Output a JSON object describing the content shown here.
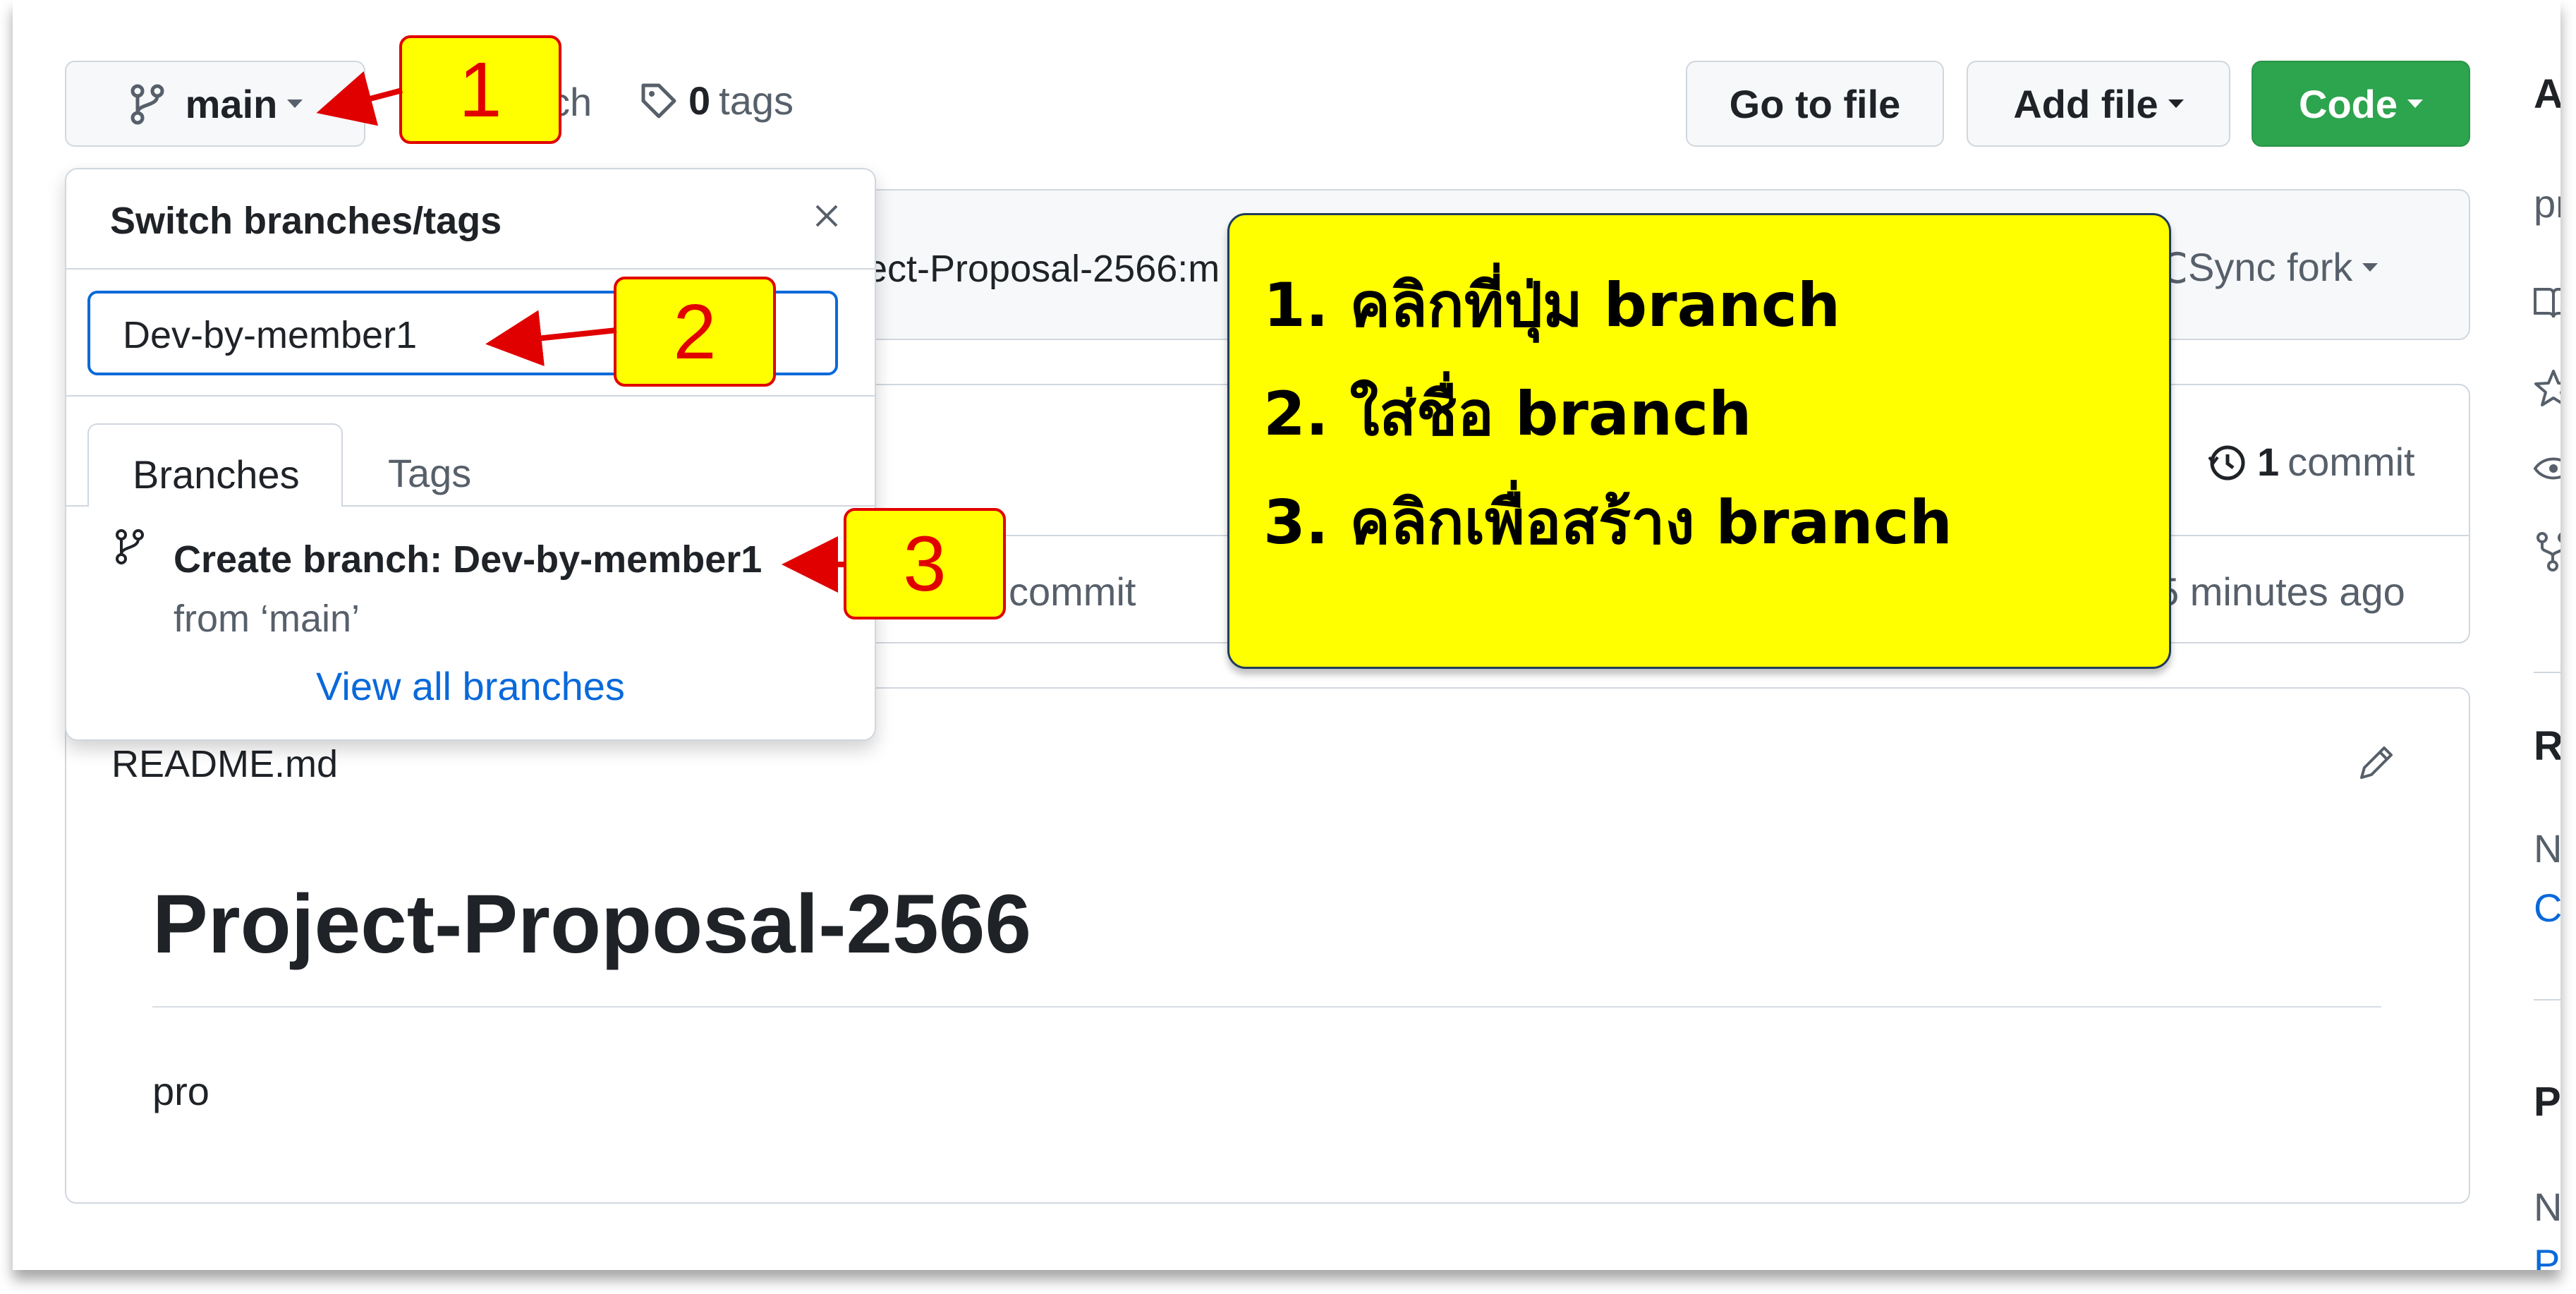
{
  "toolbar": {
    "branch_label": "main",
    "branch_count_fragment": "ch",
    "tags_count": "0",
    "tags_label": "tags",
    "go_to_file": "Go to file",
    "add_file": "Add file",
    "code": "Code"
  },
  "dropdown": {
    "title": "Switch branches/tags",
    "search_value": "Dev-by-member1",
    "tabs": [
      "Branches",
      "Tags"
    ],
    "create_branch_text": "Create branch: Dev-by-member1",
    "from_text": "from ‘main’",
    "view_all": "View all branches"
  },
  "fork_bar": {
    "text_fragment": "ect-Proposal-2566:m",
    "sync_fork": "Sync fork"
  },
  "commit_bar": {
    "commit_count": "1",
    "commit_label": "commit",
    "commit_fragment": "commit",
    "time_ago": "5 minutes ago"
  },
  "readme": {
    "filename": "README.md",
    "heading": "Project-Proposal-2566",
    "body": "pro"
  },
  "sidebar": {
    "about_fragment": "Ab",
    "desc_fragment": "pr",
    "releases_fragment": "Re",
    "releases_none_fragment": "No",
    "releases_create_fragment": "Cr",
    "packages_fragment": "Pa",
    "packages_none_fragment": "No",
    "packages_link_fragment": "Pu"
  },
  "annotations": {
    "step1": "1",
    "step2": "2",
    "step3": "3",
    "note_line1": "1.  คลิกที่ปุ่ม branch",
    "note_line2": "2.  ใส่ชื่อ branch",
    "note_line3": "3.  คลิกเพื่อสร้าง branch"
  },
  "colors": {
    "code_button": "#2da44e",
    "link": "#0969da",
    "callout_fill": "#ffff00",
    "callout_border": "#e00000",
    "arrow": "#e00000"
  }
}
